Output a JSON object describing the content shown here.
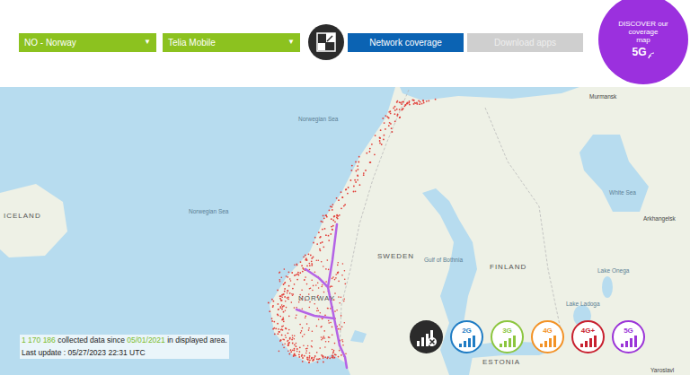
{
  "header": {
    "country_select": {
      "value": "NO - Norway",
      "arrow": "▼"
    },
    "operator_select": {
      "value": "Telia Mobile",
      "arrow": "▼"
    },
    "tabs": [
      {
        "label": "Network coverage",
        "selected": true
      },
      {
        "label": "Download apps",
        "selected": false
      }
    ],
    "promo": {
      "lines": [
        "DISCOVER our",
        "coverage",
        "map"
      ],
      "badge": "5G"
    }
  },
  "map": {
    "labels": [
      {
        "text": "Murmansk",
        "kind": "city"
      },
      {
        "text": "Norwegian Sea",
        "kind": "sea"
      },
      {
        "text": "Norwegian Sea",
        "kind": "sea"
      },
      {
        "text": "ICELAND",
        "kind": "country"
      },
      {
        "text": "SWEDEN",
        "kind": "country"
      },
      {
        "text": "Gulf of Bothnia",
        "kind": "sea"
      },
      {
        "text": "FINLAND",
        "kind": "country"
      },
      {
        "text": "White Sea",
        "kind": "sea"
      },
      {
        "text": "Arkhangelsk",
        "kind": "city"
      },
      {
        "text": "NORWAY",
        "kind": "country"
      },
      {
        "text": "Lake Onega",
        "kind": "sea"
      },
      {
        "text": "Lake Ladoga",
        "kind": "sea"
      },
      {
        "text": "ESTONIA",
        "kind": "country"
      },
      {
        "text": "Yaroslavl",
        "kind": "city"
      }
    ]
  },
  "stats": {
    "count": "1 170 186",
    "middle": "collected data since",
    "since": "05/01/2021",
    "end": "in displayed area.",
    "update": "Last update : 05/27/2023 22:31 UTC"
  },
  "legend": [
    {
      "label": "",
      "kind": "none",
      "color": "#2b2b2b"
    },
    {
      "label": "2G",
      "kind": "tech",
      "color": "#1f7cc4"
    },
    {
      "label": "3G",
      "kind": "tech",
      "color": "#8cc63f"
    },
    {
      "label": "4G",
      "kind": "tech",
      "color": "#f39226"
    },
    {
      "label": "4G+",
      "kind": "tech",
      "color": "#c8202f"
    },
    {
      "label": "5G",
      "kind": "tech",
      "color": "#9b34d8"
    }
  ]
}
